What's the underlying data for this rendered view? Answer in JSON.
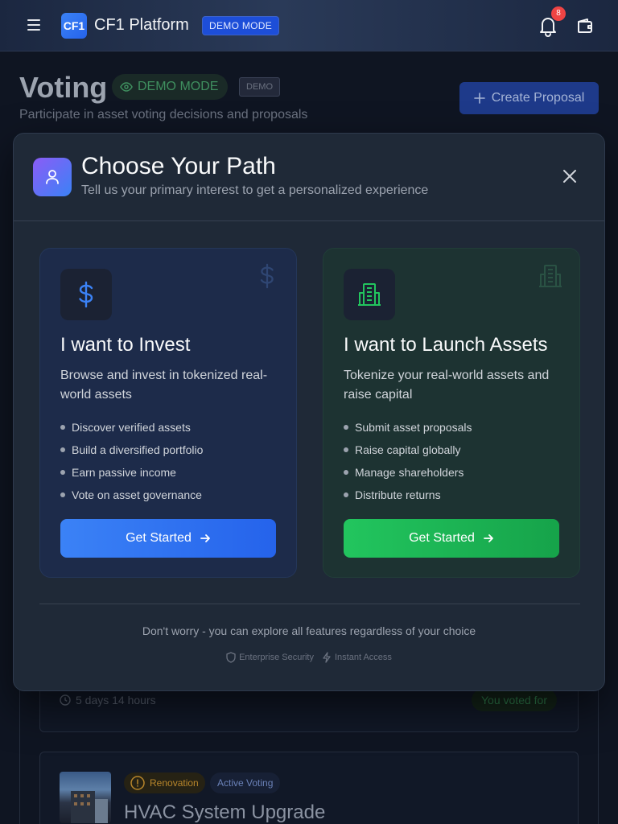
{
  "topbar": {
    "logo": "CF1",
    "brand": "CF1 Platform",
    "demo_label": "DEMO MODE",
    "notification_count": "8"
  },
  "page": {
    "title": "Voting",
    "demo_chip": "DEMO MODE",
    "demo_tag": "DEMO",
    "subtitle": "Participate in asset voting decisions and proposals",
    "create_button": "Create Proposal"
  },
  "background": {
    "timer": "5 days 14 hours",
    "voted_for": "You voted for",
    "proposal2": {
      "category": "Renovation",
      "status": "Active Voting",
      "title": "HVAC System Upgrade"
    }
  },
  "modal": {
    "title": "Choose Your Path",
    "subtitle": "Tell us your primary interest to get a personalized experience",
    "cards": [
      {
        "title": "I want to Invest",
        "description": "Browse and invest in tokenized real-world assets",
        "features": [
          "Discover verified assets",
          "Build a diversified portfolio",
          "Earn passive income",
          "Vote on asset governance"
        ],
        "button": "Get Started",
        "icon": "dollar-icon",
        "accent": "#3b82f6"
      },
      {
        "title": "I want to Launch Assets",
        "description": "Tokenize your real-world assets and raise capital",
        "features": [
          "Submit asset proposals",
          "Raise capital globally",
          "Manage shareholders",
          "Distribute returns"
        ],
        "button": "Get Started",
        "icon": "building-icon",
        "accent": "#22c55e"
      }
    ],
    "footer_note": "Don't worry - you can explore all features regardless of your choice",
    "footer_badges": [
      "Enterprise Security",
      "Instant Access"
    ]
  }
}
